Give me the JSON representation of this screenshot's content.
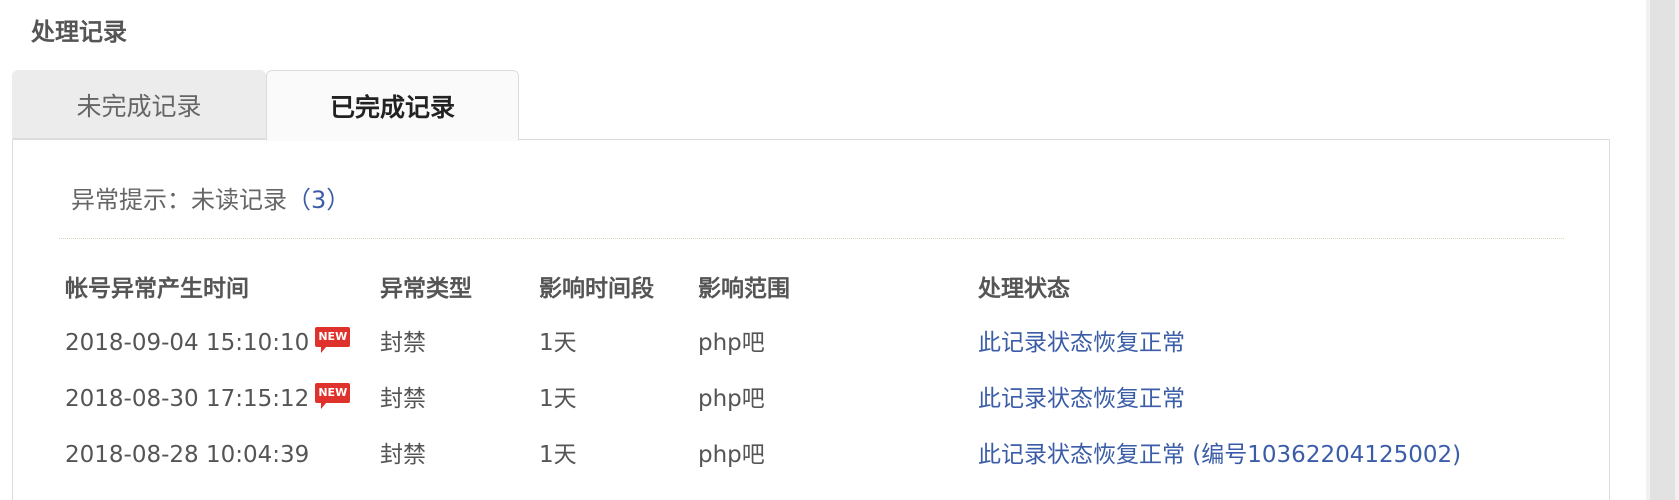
{
  "section_title": "处理记录",
  "tabs": [
    {
      "label": "未完成记录",
      "active": false
    },
    {
      "label": "已完成记录",
      "active": true
    }
  ],
  "notice": {
    "prefix": "异常提示：未读记录",
    "count": "（3）"
  },
  "table": {
    "headers": [
      "帐号异常产生时间",
      "异常类型",
      "影响时间段",
      "影响范围",
      "处理状态"
    ],
    "rows": [
      {
        "time": "2018-09-04 15:10:10",
        "is_new": true,
        "badge": "NEW",
        "type": "封禁",
        "duration": "1天",
        "scope": "php吧",
        "status": "此记录状态恢复正常"
      },
      {
        "time": "2018-08-30 17:15:12",
        "is_new": true,
        "badge": "NEW",
        "type": "封禁",
        "duration": "1天",
        "scope": "php吧",
        "status": "此记录状态恢复正常"
      },
      {
        "time": "2018-08-28 10:04:39",
        "is_new": false,
        "type": "封禁",
        "duration": "1天",
        "scope": "php吧",
        "status": "此记录状态恢复正常 (编号10362204125002)"
      }
    ]
  },
  "colors": {
    "link": "#3b5da8",
    "badge": "#e0322c",
    "tab_inactive_bg": "#ececec"
  }
}
